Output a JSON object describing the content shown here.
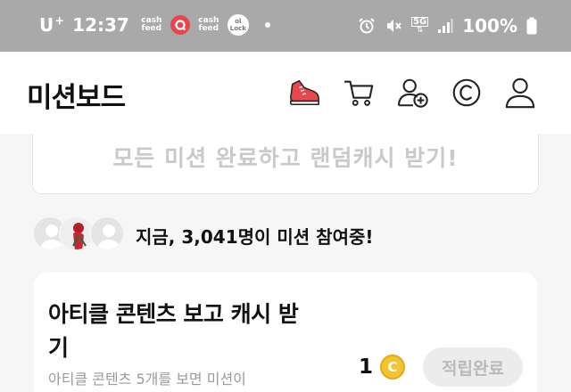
{
  "status_bar": {
    "carrier": "U",
    "carrier_sup": "+",
    "time": "12:37",
    "app1_line1": "cash",
    "app1_line2": "feed",
    "app3_line1": "cash",
    "app3_line2": "feed",
    "app4_line1": "ol",
    "app4_line2": "Lock",
    "network": "5G",
    "battery": "100%",
    "icons": [
      "alarm-icon",
      "vibrate-mute-icon",
      "signal-icon",
      "battery-icon"
    ]
  },
  "header": {
    "title": "미션보드",
    "icons": [
      "sneaker-icon",
      "cart-icon",
      "add-user-icon",
      "coin-c-icon",
      "profile-icon"
    ]
  },
  "banner": {
    "text": "모든 미션 완료하고 랜덤캐시 받기!"
  },
  "participants": {
    "prefix": "지금, ",
    "count": "3,041명",
    "suffix": "이 미션 참여중!"
  },
  "mission_card": {
    "title": "아티클 콘텐츠 보고 캐시 받기",
    "description": "아티클 콘텐츠 5개를 보면 미션이",
    "reward": "1",
    "coin_symbol": "C",
    "button_label": "적립완료"
  },
  "colors": {
    "status_bar": "#a9a9a9",
    "sneaker_accent": "#e8474f",
    "coin": "#f4c430",
    "muted_text": "#c9c9c9"
  }
}
